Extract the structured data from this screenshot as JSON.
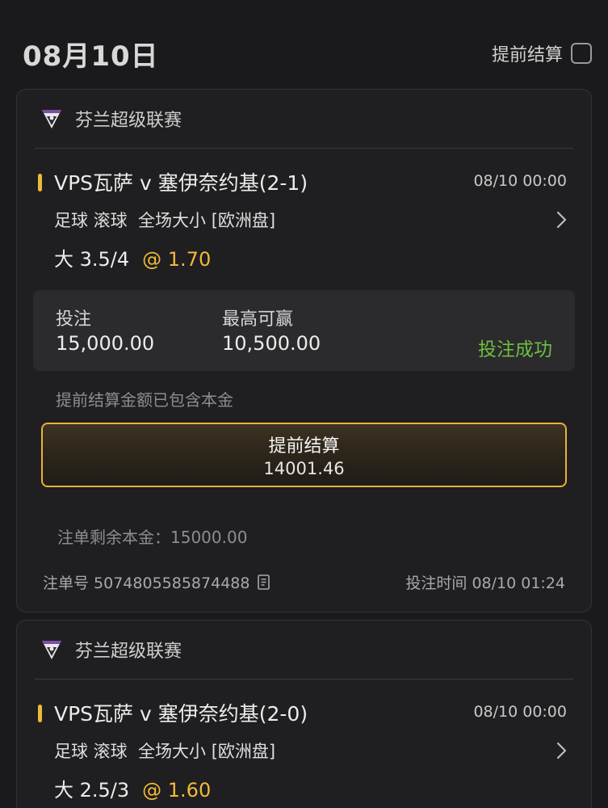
{
  "header": {
    "date": "08月10日",
    "settle_toggle_label": "提前结算"
  },
  "bets": [
    {
      "league": "芬兰超级联赛",
      "match": "VPS瓦萨 v 塞伊奈约基(2-1)",
      "match_time": "08/10 00:00",
      "market": "足球 滚球  全场大小 [欧洲盘]",
      "pick": "大 3.5/4",
      "odds": "@ 1.70",
      "stake_label": "投注",
      "stake_value": "15,000.00",
      "max_win_label": "最高可赢",
      "max_win_value": "10,500.00",
      "status": "投注成功",
      "settle_note": "提前结算金额已包含本金",
      "cashout_label": "提前结算",
      "cashout_amount": "14001.46",
      "remaining_principal": "注单剩余本金：15000.00",
      "order_no": "注单号 5074805585874488",
      "bet_time": "投注时间 08/10 01:24"
    },
    {
      "league": "芬兰超级联赛",
      "match": "VPS瓦萨 v 塞伊奈约基(2-0)",
      "match_time": "08/10 00:00",
      "market": "足球 滚球  全场大小 [欧洲盘]",
      "pick": "大 2.5/3",
      "odds": "@ 1.60"
    }
  ],
  "colors": {
    "background": "#1a1a1c",
    "card": "#1f1f21",
    "accent_gold": "#f0b93a",
    "success_green": "#6ebf3e"
  }
}
